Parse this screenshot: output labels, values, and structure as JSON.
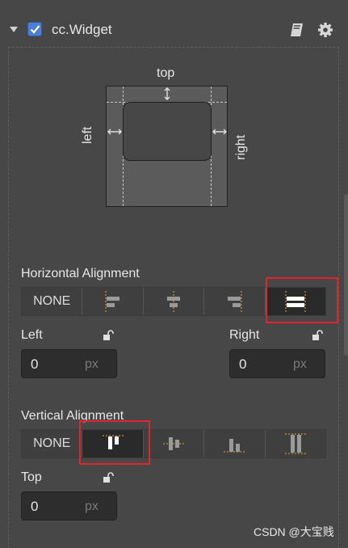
{
  "header": {
    "title": "cc.Widget",
    "enabled": true
  },
  "preview": {
    "top_label": "top",
    "left_label": "left",
    "right_label": "right"
  },
  "horizontal": {
    "label": "Horizontal Alignment",
    "options": [
      "NONE",
      "align-left-icon",
      "align-center-h-icon",
      "align-right-icon",
      "stretch-h-icon"
    ],
    "selected": "stretch-h-icon",
    "left_label": "Left",
    "left_value": "0",
    "right_label": "Right",
    "right_value": "0",
    "unit": "px"
  },
  "vertical": {
    "label": "Vertical Alignment",
    "options": [
      "NONE",
      "align-top-icon",
      "align-center-v-icon",
      "align-bottom-icon",
      "stretch-v-icon"
    ],
    "selected": "align-top-icon",
    "top_label": "Top",
    "top_value": "0",
    "unit": "px"
  },
  "watermark": "CSDN @大宝贱",
  "colors": {
    "accent": "#4d7fd6",
    "highlight": "#e0262b",
    "guide": "#e8a33a"
  }
}
